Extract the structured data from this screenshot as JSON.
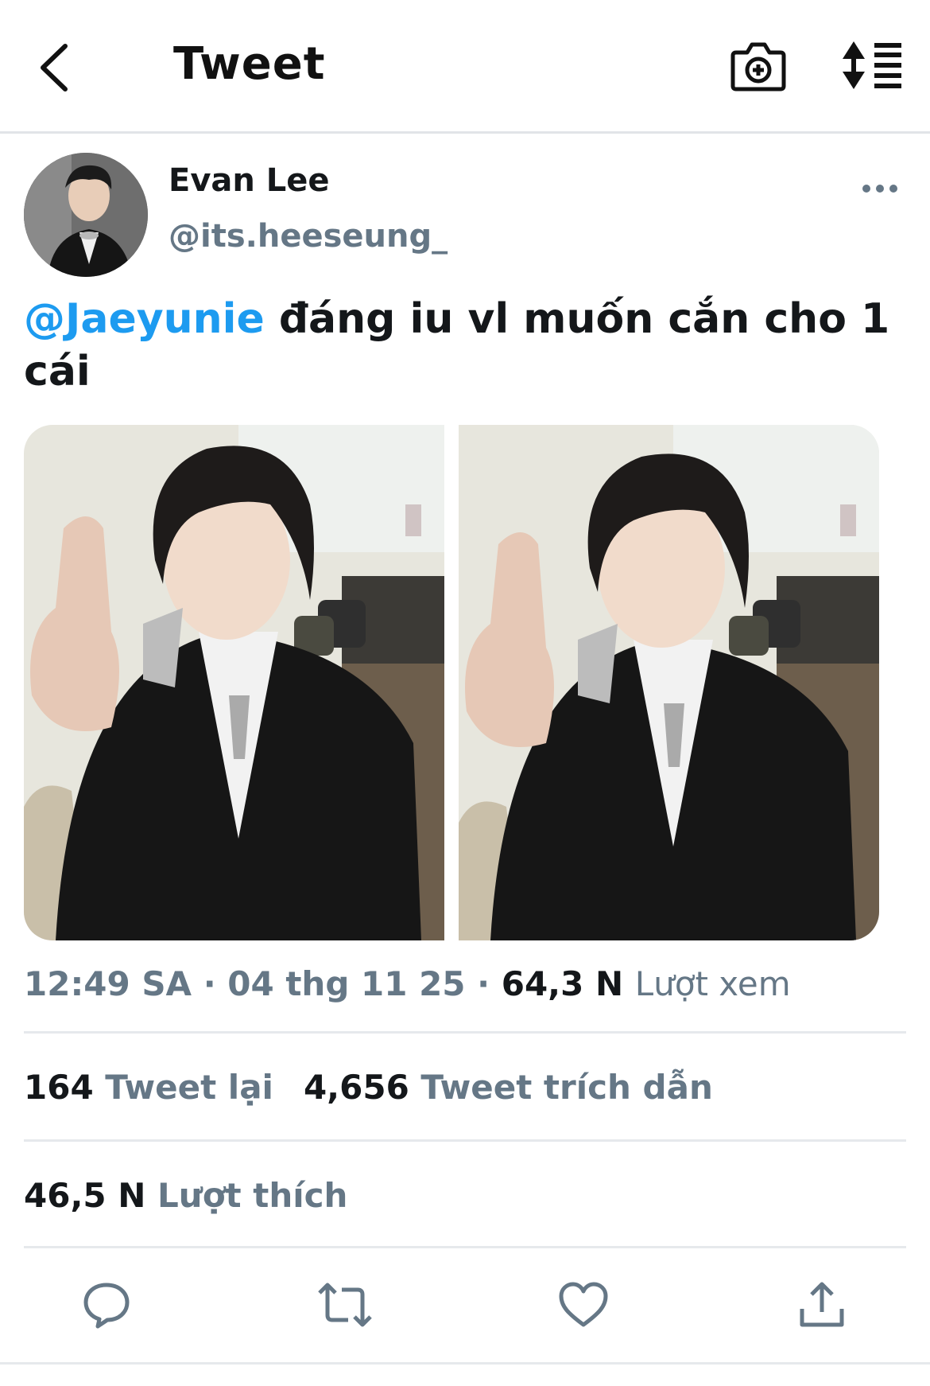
{
  "header": {
    "title": "Tweet",
    "back_icon": "chevron-left-icon",
    "camera_icon": "camera-plus-icon",
    "sort_icon": "sort-list-icon"
  },
  "author": {
    "display_name": "Evan Lee",
    "handle": "@its.heeseung_",
    "more_icon": "more-horizontal-icon"
  },
  "tweet": {
    "mention": "@Jaeyunie",
    "text": " đáng iu vl muốn cắn cho 1 cái",
    "media_count": 2
  },
  "meta": {
    "time": "12:49 SA",
    "separator": " · ",
    "date": "04 thg 11 25",
    "views_count": "64,3 N",
    "views_label": "Lượt xem"
  },
  "stats": {
    "retweets_count": "164",
    "retweets_label": "Tweet lại",
    "quotes_count": "4,656",
    "quotes_label": "Tweet trích dẫn",
    "likes_count": "46,5 N",
    "likes_label": "Lượt thích"
  },
  "actions": {
    "reply_icon": "reply-bubble-icon",
    "retweet_icon": "retweet-icon",
    "like_icon": "heart-icon",
    "share_icon": "share-upload-icon"
  },
  "colors": {
    "accent": "#1d9bf0",
    "secondary_text": "#657786",
    "primary_text": "#14171a"
  }
}
